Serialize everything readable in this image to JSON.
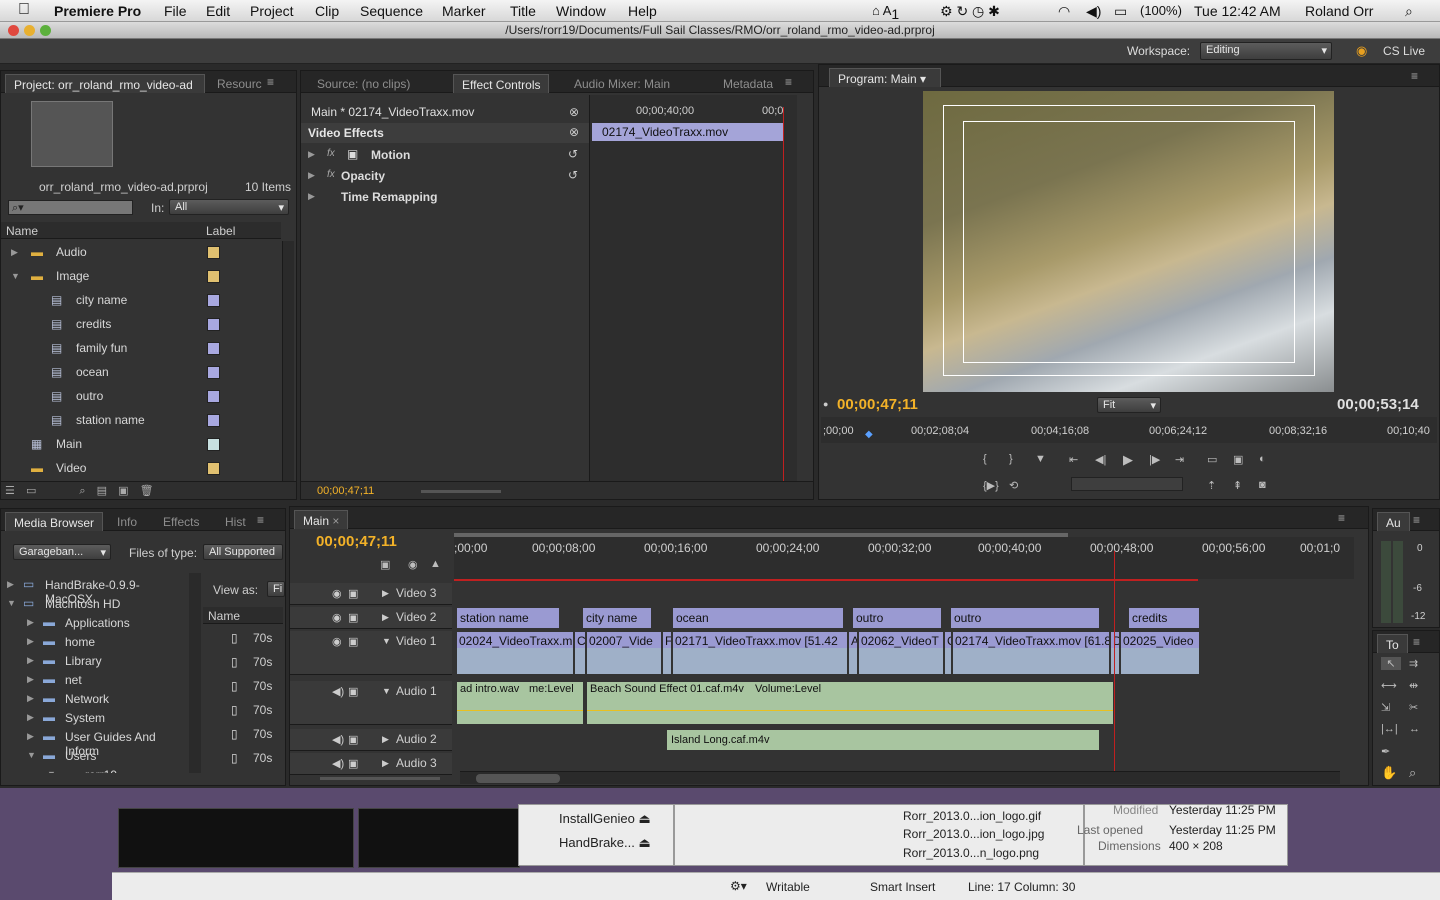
{
  "menubar": {
    "app": "Premiere Pro",
    "items": [
      "File",
      "Edit",
      "Project",
      "Clip",
      "Sequence",
      "Marker",
      "Title",
      "Window",
      "Help"
    ],
    "battery": "(100%)",
    "clock": "Tue 12:42 AM",
    "user": "Roland Orr",
    "adobe_badge": "1"
  },
  "window": {
    "path": "/Users/rorr19/Documents/Full Sail Classes/RMO/orr_roland_rmo_video-ad.prproj"
  },
  "workspace": {
    "label": "Workspace:",
    "value": "Editing",
    "cslive": "CS Live"
  },
  "project": {
    "tab": "Project: orr_roland_rmo_video-ad",
    "tab2": "Resourc",
    "filename": "orr_roland_rmo_video-ad.prproj",
    "count": "10 Items",
    "in_label": "In:",
    "in_value": "All",
    "col_name": "Name",
    "col_label": "Label",
    "items": [
      {
        "name": "Audio",
        "color": "#e0c070"
      },
      {
        "name": "Image",
        "color": "#e0c070"
      },
      {
        "name": "city name",
        "color": "#a8a8e0"
      },
      {
        "name": "credits",
        "color": "#a8a8e0"
      },
      {
        "name": "family fun",
        "color": "#a8a8e0"
      },
      {
        "name": "ocean",
        "color": "#a8a8e0"
      },
      {
        "name": "outro",
        "color": "#a8a8e0"
      },
      {
        "name": "station name",
        "color": "#a8a8e0"
      },
      {
        "name": "Main",
        "color": "#c8e0e0"
      },
      {
        "name": "Video",
        "color": "#e0c070"
      }
    ]
  },
  "effects": {
    "tabs": [
      "Source: (no clips)",
      "Effect Controls",
      "Audio Mixer: Main",
      "Metadata"
    ],
    "clip": "Main * 02174_VideoTraxx.mov",
    "section": "Video Effects",
    "items": [
      "Motion",
      "Opacity",
      "Time Remapping"
    ],
    "ruler_tc": "00;00;40;00",
    "ruler_tc2": "00;0",
    "clip_bar": "02174_VideoTraxx.mov",
    "timecode": "00;00;47;11"
  },
  "program": {
    "tab": "Program: Main",
    "tc_in": "00;00;47;11",
    "tc_out": "00;00;53;14",
    "fit": "Fit",
    "ruler": [
      ";00;00",
      "00;02;08;04",
      "00;04;16;08",
      "00;06;24;12",
      "00;08;32;16",
      "00;10;40"
    ]
  },
  "media": {
    "tabs": [
      "Media Browser",
      "Info",
      "Effects",
      "Hist"
    ],
    "drive_sel": "Garageban...",
    "files_label": "Files of type:",
    "files_value": "All Supported",
    "view_label": "View as:",
    "view_val": "Fi",
    "col_name": "Name",
    "tree": [
      "HandBrake-0.9.9-MacOSX.",
      "Macintosh HD",
      "Applications",
      "home",
      "Library",
      "net",
      "Network",
      "System",
      "User Guides And Inform",
      "Users",
      "rorr19"
    ],
    "files": [
      "70s",
      "70s",
      "70s",
      "70s",
      "70s",
      "70s"
    ]
  },
  "timeline": {
    "tab": "Main",
    "timecode": "00;00;47;11",
    "ruler": [
      ";00;00",
      "00;00;08;00",
      "00;00;16;00",
      "00;00;24;00",
      "00;00;32;00",
      "00;00;40;00",
      "00;00;48;00",
      "00;00;56;00",
      "00;01;0"
    ],
    "tracks": [
      "Video 3",
      "Video 2",
      "Video 1",
      "Audio 1",
      "Audio 2",
      "Audio 3"
    ],
    "v2": [
      "station name",
      "city name",
      "ocean",
      "outro",
      "outro",
      "credits"
    ],
    "v1": [
      "02024_VideoTraxx.m",
      "C",
      "02007_Vide",
      "F",
      "02171_VideoTraxx.mov [51.42",
      "A",
      "02062_VideoT",
      "C",
      "02174_VideoTraxx.mov [61.8",
      "D",
      "02025_Video"
    ],
    "a1": [
      "ad intro.wav",
      "me:Level",
      "Beach Sound Effect 01.caf.m4v",
      "Volume:Level"
    ],
    "a2": [
      "Island Long.caf.m4v"
    ]
  },
  "audio_meter": {
    "tab": "Au",
    "marks": [
      "0",
      "-6",
      "-12"
    ]
  },
  "tools": {
    "tab": "To"
  },
  "background": {
    "finder_items": [
      "InstallGenieo",
      "HandBrake..."
    ],
    "files": [
      "Rorr_2013.0...ion_logo.gif",
      "Rorr_2013.0...ion_logo.jpg",
      "Rorr_2013.0...n_logo.png"
    ],
    "info": [
      {
        "k": "Modified",
        "v": "Yesterday 11:25 PM"
      },
      {
        "k": "Last opened",
        "v": "Yesterday 11:25 PM"
      },
      {
        "k": "Dimensions",
        "v": "400 × 208"
      }
    ],
    "status": [
      "Writable",
      "Smart Insert",
      "Line: 17 Column: 30"
    ]
  }
}
